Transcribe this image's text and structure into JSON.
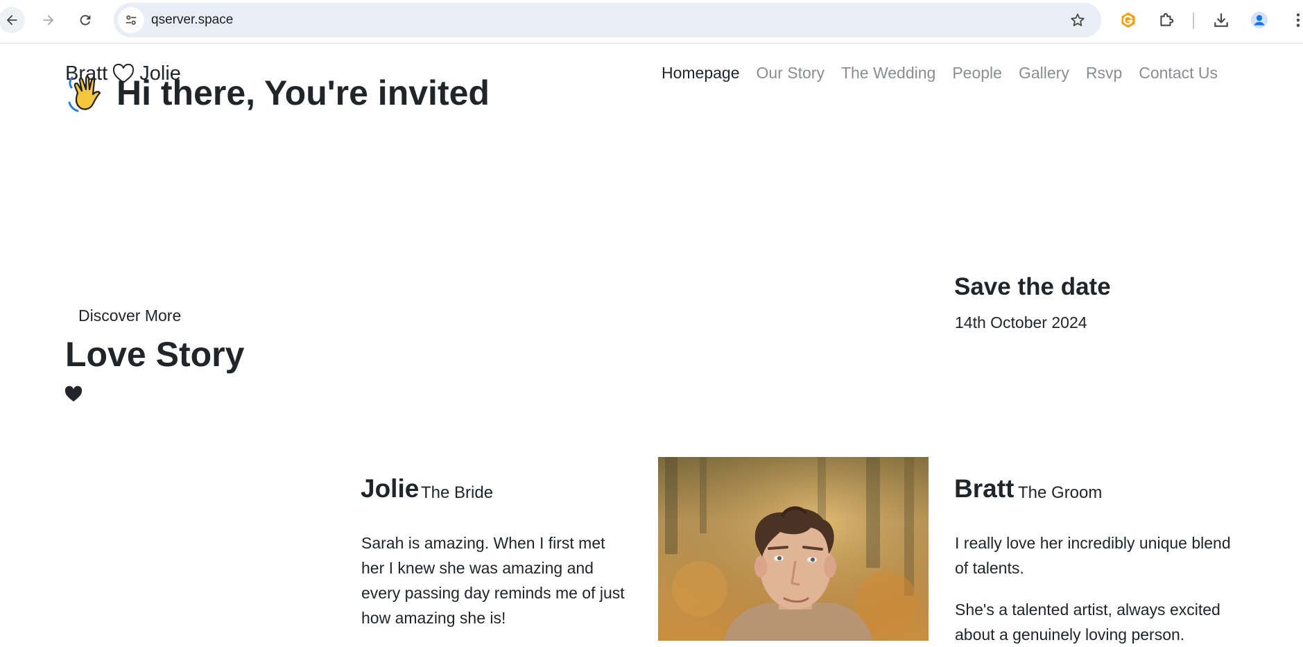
{
  "browser": {
    "url": "qserver.space",
    "icons": {
      "back": "arrow-left-icon",
      "forward": "arrow-right-icon",
      "reload": "reload-icon",
      "site_info": "tune-icon",
      "bookmark": "star-icon",
      "extension_g": "g-extension-icon",
      "extensions": "puzzle-icon",
      "download": "download-icon",
      "profile": "profile-icon",
      "menu": "kebab-menu-icon"
    }
  },
  "site": {
    "brand": {
      "first": "Bratt",
      "second": "Jolie",
      "icon": "heart-outline-icon"
    },
    "nav": [
      {
        "label": "Homepage",
        "active": true
      },
      {
        "label": "Our Story",
        "active": false
      },
      {
        "label": "The Wedding",
        "active": false
      },
      {
        "label": "People",
        "active": false
      },
      {
        "label": "Gallery",
        "active": false
      },
      {
        "label": "Rsvp",
        "active": false
      },
      {
        "label": "Contact Us",
        "active": false
      }
    ],
    "hero": {
      "title": "Hi there, You're invited",
      "icon": "waving-hand-icon"
    },
    "discover": "Discover More",
    "love_story": {
      "title": "Love Story",
      "icon": "heart-solid-icon"
    },
    "save_date": {
      "title": "Save the date",
      "date": "14th October 2024"
    },
    "bride": {
      "name": "Jolie",
      "role": "The Bride",
      "bio": "Sarah is amazing. When I first met her I knew she was amazing and every passing day reminds me of just how amazing she is!"
    },
    "groom": {
      "name": "Bratt",
      "role": "The Groom",
      "bio": [
        "I really love her incredibly unique blend of talents.",
        "She's a talented artist, always excited about a genuinely loving person."
      ]
    }
  },
  "colors": {
    "text": "#212529",
    "nav_muted": "#8a8d90",
    "omnibox": "#e9edf6",
    "extension_orange": "#f59e0b",
    "profile_blue": "#1a73e8"
  }
}
